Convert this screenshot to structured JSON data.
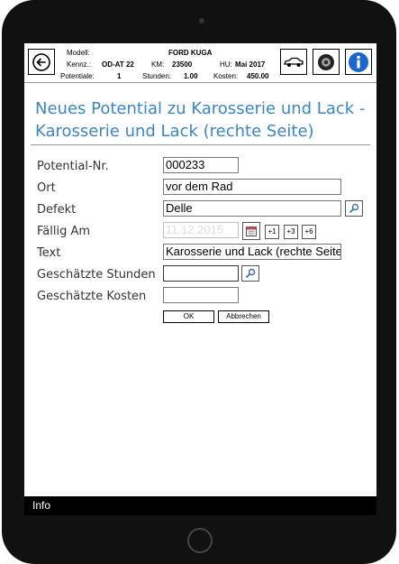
{
  "header": {
    "modell_label": "Modell:",
    "modell_value": "FORD KUGA",
    "kennz_label": "Kennz.:",
    "kennz_value": "OD-AT 22",
    "km_label": "KM:",
    "km_value": "23500",
    "hu_label": "HU:",
    "hu_value": "Mai 2017",
    "potentiale_label": "Potentiale:",
    "potentiale_value": "1",
    "stunden_label": "Stunden:",
    "stunden_value": "1.00",
    "kosten_label": "Kosten:",
    "kosten_value": "450.00"
  },
  "page": {
    "title": "Neues Potential zu Karosserie und Lack - Karosserie und Lack (rechte Seite)"
  },
  "form": {
    "potential_nr_label": "Potential-Nr.",
    "potential_nr_value": "000233",
    "ort_label": "Ort",
    "ort_value": "vor dem Rad",
    "defekt_label": "Defekt",
    "defekt_value": "Delle",
    "faellig_label": "Fällig Am",
    "faellig_value": "11.12.2015",
    "plus1_label": "+1",
    "plus3_label": "+3",
    "plus6_label": "+6",
    "text_label": "Text",
    "text_value": "Karosserie und Lack (rechte Seite)",
    "stunden_label": "Geschätzte Stunden",
    "stunden_value": "",
    "kosten_label": "Geschätzte Kosten",
    "kosten_value": "",
    "ok_label": "OK",
    "cancel_label": "Abbrechen"
  },
  "footer": {
    "info_label": "Info"
  },
  "icons": {
    "back": "back-arrow-icon",
    "car": "car-icon",
    "tire": "tire-icon",
    "info": "info-icon",
    "search": "search-icon",
    "calendar": "calendar-icon"
  }
}
